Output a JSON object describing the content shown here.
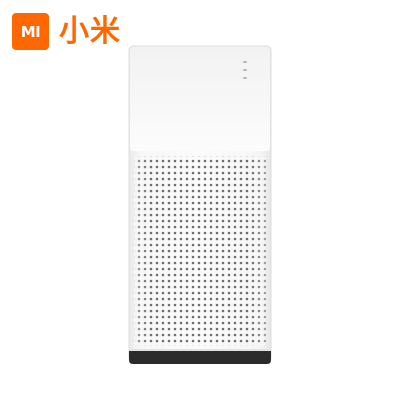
{
  "brand": {
    "logo_text": "MI",
    "name": "小米",
    "color": "#ff6700"
  },
  "product": {
    "body_color": "#fafafa",
    "base_color": "#2b2b2b",
    "indicator_icons": [
      "status-light-icon",
      "status-light-icon",
      "status-light-icon"
    ]
  }
}
